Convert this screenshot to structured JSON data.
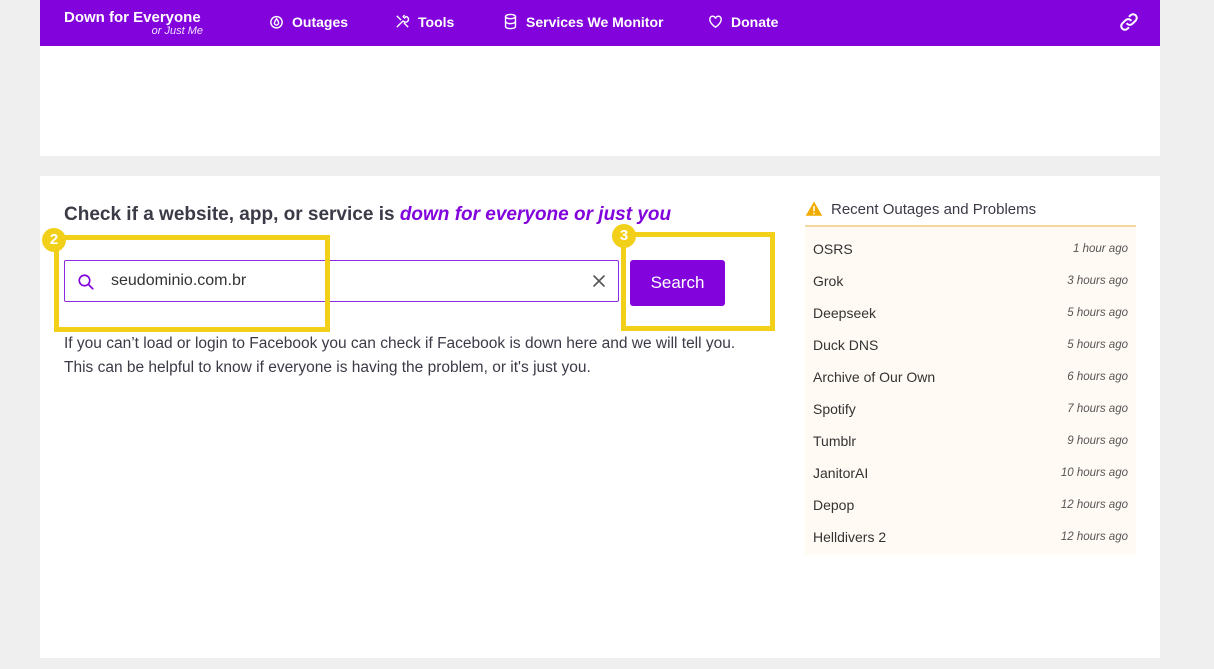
{
  "nav": {
    "brand": "Down for Everyone",
    "brand_sub": "or Just Me",
    "items": [
      {
        "label": "Outages",
        "icon": "flame-icon"
      },
      {
        "label": "Tools",
        "icon": "tools-icon"
      },
      {
        "label": "Services We Monitor",
        "icon": "database-icon"
      },
      {
        "label": "Donate",
        "icon": "heart-icon"
      }
    ],
    "link_icon": "link-icon"
  },
  "colors": {
    "brand": "#8203dc",
    "highlight": "#f2d01a",
    "warning": "#f0ad00"
  },
  "main": {
    "headline_text": "Check if a website, app, or service is ",
    "headline_accent": "down for everyone or just you",
    "search": {
      "value": "seudominio.com.br",
      "button": "Search"
    },
    "description": "If you can’t load or login to Facebook you can check if Facebook is down here and we will tell you. This can be helpful to know if everyone is having the problem, or it's just you.",
    "badges": [
      "2",
      "3"
    ]
  },
  "sidebar": {
    "title": "Recent Outages and Problems",
    "items": [
      {
        "name": "OSRS",
        "time": "1 hour ago"
      },
      {
        "name": "Grok",
        "time": "3 hours ago"
      },
      {
        "name": "Deepseek",
        "time": "5 hours ago"
      },
      {
        "name": "Duck DNS",
        "time": "5 hours ago"
      },
      {
        "name": "Archive of Our Own",
        "time": "6 hours ago"
      },
      {
        "name": "Spotify",
        "time": "7 hours ago"
      },
      {
        "name": "Tumblr",
        "time": "9 hours ago"
      },
      {
        "name": "JanitorAI",
        "time": "10 hours ago"
      },
      {
        "name": "Depop",
        "time": "12 hours ago"
      },
      {
        "name": "Helldivers 2",
        "time": "12 hours ago"
      }
    ]
  }
}
